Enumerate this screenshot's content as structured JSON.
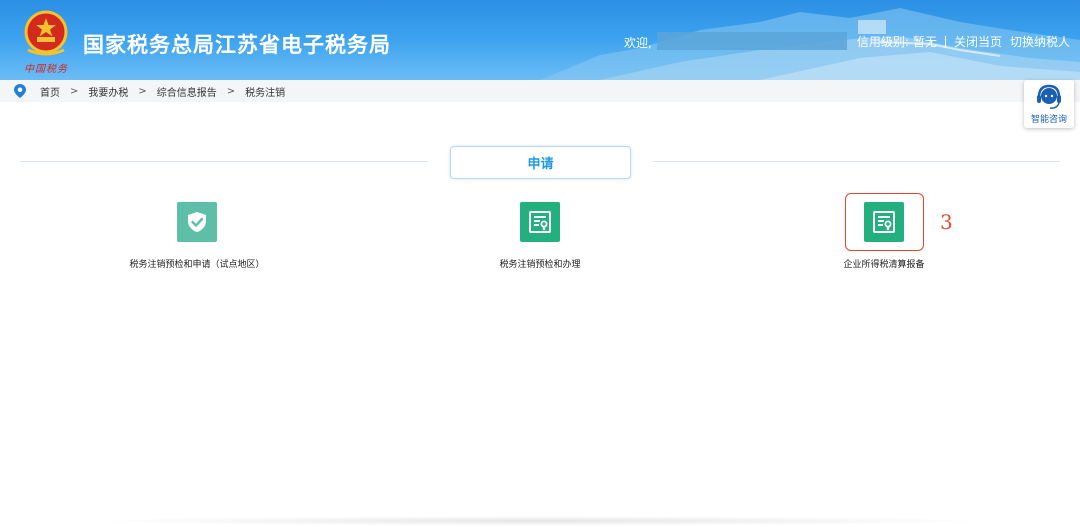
{
  "header": {
    "title": "国家税务总局江苏省电子税务局",
    "slogan": "中国税务",
    "welcome": "欢迎,",
    "credit_label": "信用级别:",
    "credit_value": "暂无",
    "close_label": "关闭当页",
    "switch_label": "切换纳税人",
    "bg_color": "#3aa1ee"
  },
  "breadcrumb": {
    "items": [
      "首页",
      "我要办税",
      "综合信息报告",
      "税务注销"
    ],
    "separator": ">"
  },
  "consult": {
    "label": "智能咨询",
    "icon": "headset-icon"
  },
  "section": {
    "tab_label": "申请"
  },
  "services": [
    {
      "label": "税务注销预检和申请（试点地区）",
      "icon": "shield-check-icon",
      "color": "#5dbfa8"
    },
    {
      "label": "税务注销预检和办理",
      "icon": "certificate-icon",
      "color": "#23b07f"
    },
    {
      "label": "企业所得税清算报备",
      "icon": "certificate-icon",
      "color": "#23b07f"
    }
  ],
  "annotation": {
    "marker": "3",
    "color": "#e8452e"
  }
}
